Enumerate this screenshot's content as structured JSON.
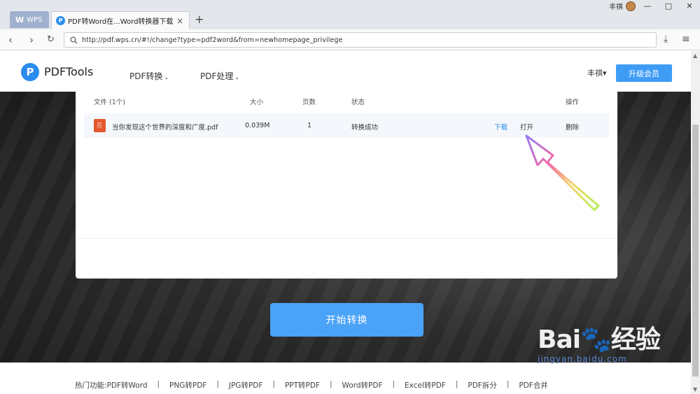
{
  "browser": {
    "tabs": [
      {
        "label": "WPS"
      },
      {
        "label": "PDF转Word在...Word转换器下载",
        "close": "×"
      }
    ],
    "new_tab": "+",
    "user_name": "丰祺",
    "window_controls": [
      "—",
      "□",
      "✕"
    ],
    "url": "http://pdf.wps.cn/#!/change?type=pdf2word&from=newhomepage_privilege"
  },
  "header": {
    "logo_letter": "P",
    "brand": "PDFTools",
    "nav": [
      {
        "label": "PDF转换"
      },
      {
        "label": "PDF处理"
      }
    ],
    "user": "丰祺▾",
    "upgrade": "升级会员"
  },
  "table": {
    "columns": {
      "file": "文件 (1个)",
      "size": "大小",
      "pages": "页数",
      "status": "状态",
      "action": "操作"
    },
    "rows": [
      {
        "file_name": "当你发现这个世界的深度和广度.pdf",
        "size": "0.039M",
        "pages": "1",
        "status": "转换成功",
        "download": "下载",
        "open": "打开",
        "delete": "删除"
      }
    ]
  },
  "start_button": "开始转换",
  "footer": {
    "label": "热门功能:",
    "links": [
      "PDF转Word",
      "PNG转PDF",
      "JPG转PDF",
      "PPT转PDF",
      "Word转PDF",
      "Excel转PDF",
      "PDF拆分",
      "PDF合并"
    ],
    "separator": "|"
  },
  "watermark": {
    "text": "Bai🐾经验",
    "url": "jingyan.baidu.com"
  },
  "colors": {
    "accent": "#3f9cf5",
    "link": "#2a8cf0",
    "pdf_icon": "#e4572e"
  }
}
